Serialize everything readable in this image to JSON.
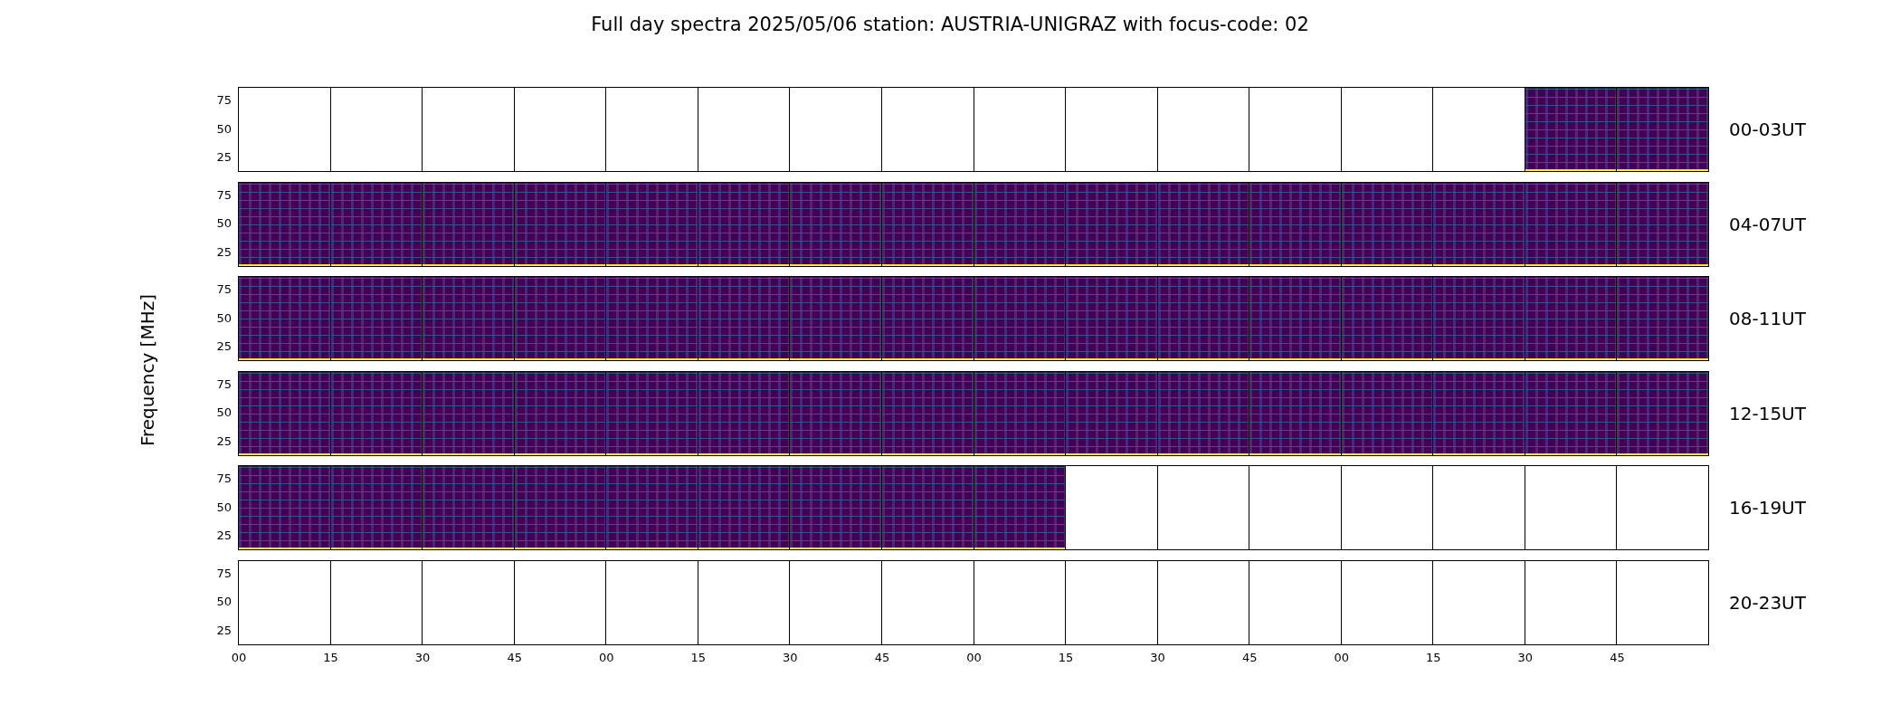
{
  "title": "Full day spectra 2025/05/06 station: AUSTRIA-UNIGRAZ with focus-code: 02",
  "y_axis_label": "Frequency [MHz]",
  "rows": [
    {
      "label": "00-03UT",
      "yticks": [
        "75",
        "50",
        "25"
      ],
      "panels": [
        {
          "has_data": false
        },
        {
          "has_data": false
        },
        {
          "has_data": false
        },
        {
          "has_data": false
        },
        {
          "has_data": false
        },
        {
          "has_data": false
        },
        {
          "has_data": false
        },
        {
          "has_data": false
        },
        {
          "has_data": false
        },
        {
          "has_data": false
        },
        {
          "has_data": false
        },
        {
          "has_data": false
        },
        {
          "has_data": false
        },
        {
          "has_data": false
        },
        {
          "has_data": true
        },
        {
          "has_data": true
        }
      ]
    },
    {
      "label": "04-07UT",
      "yticks": [
        "75",
        "50",
        "25"
      ],
      "panels": [
        {
          "has_data": true
        },
        {
          "has_data": true
        },
        {
          "has_data": true
        },
        {
          "has_data": true
        },
        {
          "has_data": true
        },
        {
          "has_data": true
        },
        {
          "has_data": true
        },
        {
          "has_data": true
        },
        {
          "has_data": true
        },
        {
          "has_data": true
        },
        {
          "has_data": true
        },
        {
          "has_data": true
        },
        {
          "has_data": true
        },
        {
          "has_data": true
        },
        {
          "has_data": true
        },
        {
          "has_data": true
        }
      ]
    },
    {
      "label": "08-11UT",
      "yticks": [
        "75",
        "50",
        "25"
      ],
      "panels": [
        {
          "has_data": true
        },
        {
          "has_data": true
        },
        {
          "has_data": true
        },
        {
          "has_data": true
        },
        {
          "has_data": true
        },
        {
          "has_data": true
        },
        {
          "has_data": true
        },
        {
          "has_data": true
        },
        {
          "has_data": true
        },
        {
          "has_data": true
        },
        {
          "has_data": true
        },
        {
          "has_data": true
        },
        {
          "has_data": true
        },
        {
          "has_data": true
        },
        {
          "has_data": true
        },
        {
          "has_data": true
        }
      ]
    },
    {
      "label": "12-15UT",
      "yticks": [
        "75",
        "50",
        "25"
      ],
      "panels": [
        {
          "has_data": true
        },
        {
          "has_data": true
        },
        {
          "has_data": true
        },
        {
          "has_data": true
        },
        {
          "has_data": true
        },
        {
          "has_data": true
        },
        {
          "has_data": true
        },
        {
          "has_data": true
        },
        {
          "has_data": true
        },
        {
          "has_data": true
        },
        {
          "has_data": true
        },
        {
          "has_data": true
        },
        {
          "has_data": true
        },
        {
          "has_data": true
        },
        {
          "has_data": true
        },
        {
          "has_data": true
        }
      ]
    },
    {
      "label": "16-19UT",
      "yticks": [
        "75",
        "50",
        "25"
      ],
      "panels": [
        {
          "has_data": true
        },
        {
          "has_data": true
        },
        {
          "has_data": true
        },
        {
          "has_data": true
        },
        {
          "has_data": true
        },
        {
          "has_data": true
        },
        {
          "has_data": true
        },
        {
          "has_data": true
        },
        {
          "has_data": true
        },
        {
          "has_data": false
        },
        {
          "has_data": false
        },
        {
          "has_data": false
        },
        {
          "has_data": false
        },
        {
          "has_data": false
        },
        {
          "has_data": false
        },
        {
          "has_data": false
        }
      ]
    },
    {
      "label": "20-23UT",
      "yticks": [
        "75",
        "50",
        "25"
      ],
      "panels": [
        {
          "has_data": false
        },
        {
          "has_data": false
        },
        {
          "has_data": false
        },
        {
          "has_data": false
        },
        {
          "has_data": false
        },
        {
          "has_data": false
        },
        {
          "has_data": false
        },
        {
          "has_data": false
        },
        {
          "has_data": false
        },
        {
          "has_data": false
        },
        {
          "has_data": false
        },
        {
          "has_data": false
        },
        {
          "has_data": false
        },
        {
          "has_data": false
        },
        {
          "has_data": false
        },
        {
          "has_data": false
        }
      ]
    }
  ],
  "x_ticks": [
    "00",
    "15",
    "30",
    "45",
    "00",
    "15",
    "30",
    "45",
    "00",
    "15",
    "30",
    "45",
    "00",
    "15",
    "30",
    "45"
  ]
}
